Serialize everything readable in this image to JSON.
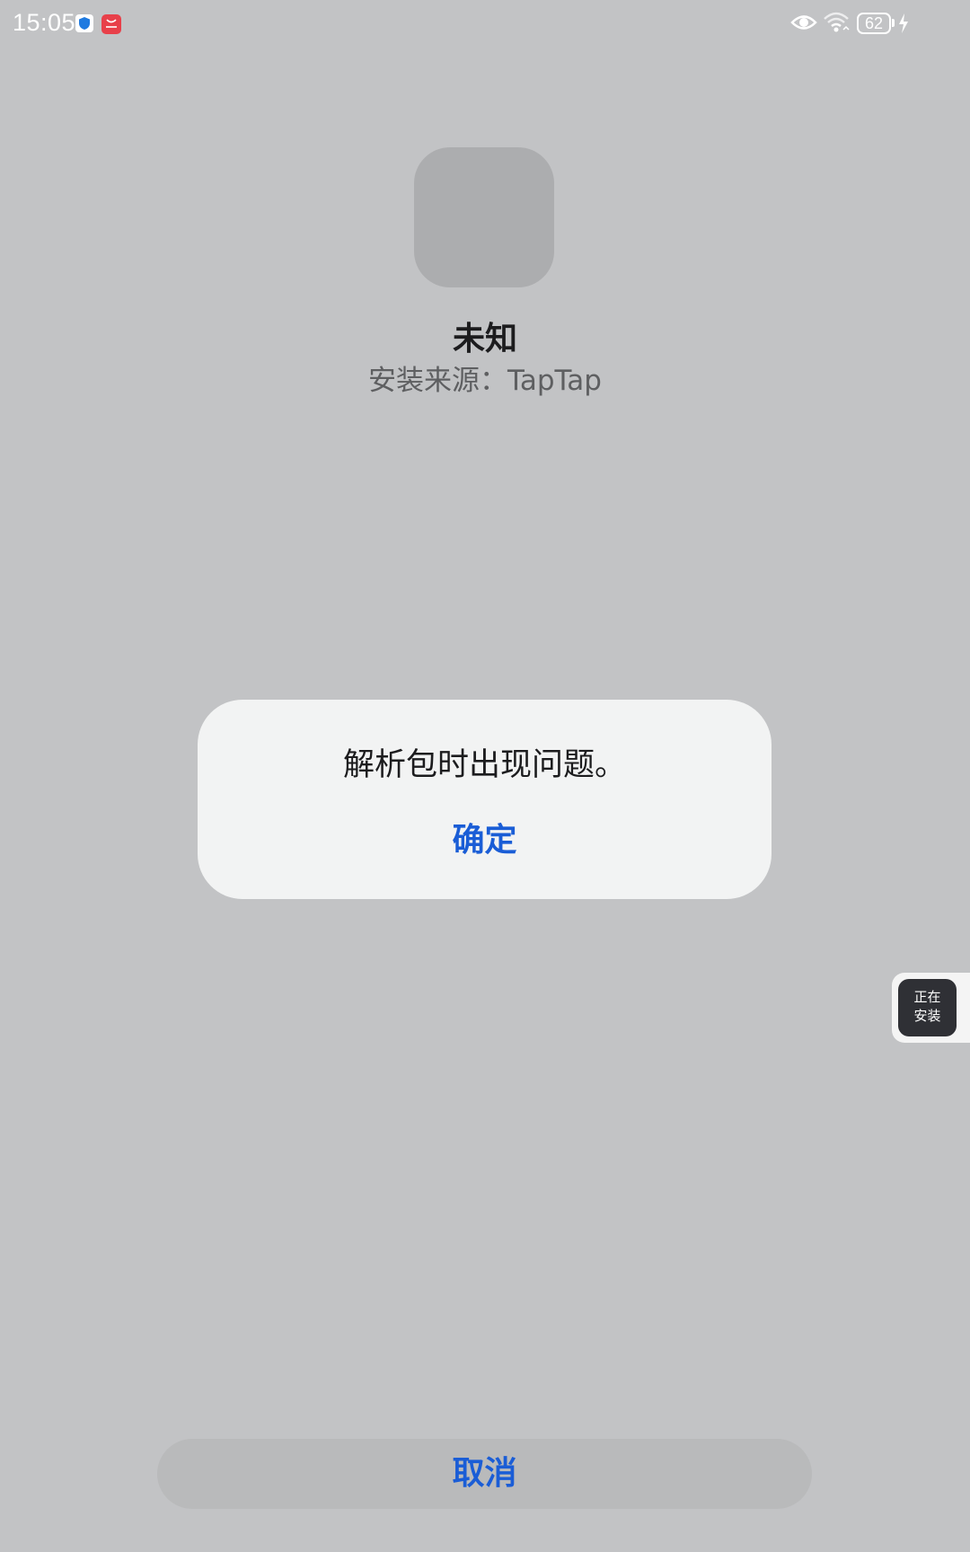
{
  "status_bar": {
    "time": "15:05",
    "battery_level": "62",
    "icons": [
      "shield-icon",
      "huawei-store-icon",
      "eye-icon",
      "wifi-icon",
      "battery-icon",
      "charging-bolt-icon"
    ]
  },
  "app": {
    "name": "未知",
    "install_source": "安装来源：TapTap"
  },
  "dialog": {
    "message": "解析包时出现问题。",
    "confirm_label": "确定"
  },
  "install_badge": {
    "line1": "正在",
    "line2": "安装"
  },
  "footer": {
    "cancel_label": "取消"
  },
  "colors": {
    "background": "#c2c3c5",
    "accent": "#1a5dd6",
    "dialog_bg": "#f2f3f3",
    "cancel_bg": "#b9babb"
  }
}
